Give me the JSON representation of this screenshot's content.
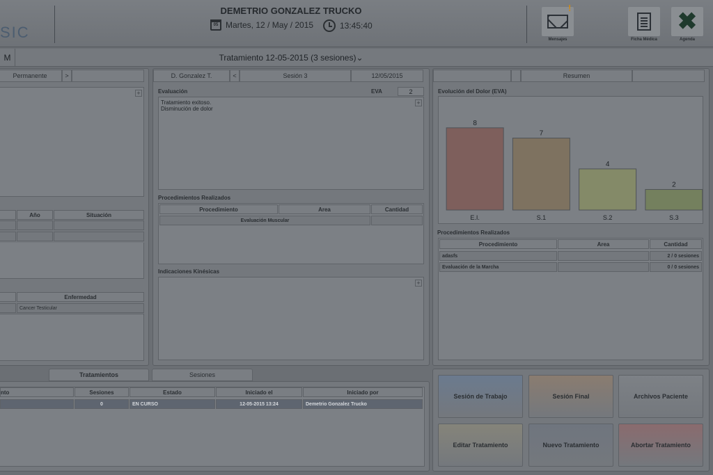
{
  "header": {
    "logo_text": "SIC",
    "patient_name": "DEMETRIO GONZALEZ TRUCKO",
    "date_text": "Martes, 12 / May / 2015",
    "calendar_day": "05",
    "time_text": "13:45:40",
    "alert_mark": "!",
    "tools": [
      {
        "label": "Mensajes",
        "icon": "mail-icon"
      },
      {
        "label": "Ficha Médica",
        "icon": "document-icon"
      },
      {
        "label": "Agenda",
        "icon": "close-icon"
      }
    ]
  },
  "treatment_bar": {
    "left_label": "M",
    "title": "Tratamiento 12-05-2015 (3 sesiones)",
    "dropdown_glyph": "⌄"
  },
  "left_panel": {
    "tab_label": "Permanente",
    "nav_glyph": ">",
    "history_headers": [
      "Año",
      "Situación"
    ],
    "disease_header": "Enfermedad",
    "disease_rows": [
      "Cancer Testicular"
    ],
    "plus": "+"
  },
  "session_panel": {
    "therapist": "D. Gonzalez T.",
    "prev_glyph": "<",
    "session_label": "Sesión 3",
    "session_date": "12/05/2015",
    "evaluation_title": "Evaluación",
    "eva_label": "EVA",
    "eva_value": "2",
    "evaluation_text": [
      "Tratamiento exitoso.",
      "Disminución de dolor"
    ],
    "procedures_title": "Procedimientos Realizados",
    "procedures_headers": [
      "Procedimiento",
      "Area",
      "Cantidad"
    ],
    "procedures_rows": [
      {
        "procedimiento": "Evaluación Muscular",
        "area": "",
        "cantidad": ""
      }
    ],
    "indications_title": "Indicaciones Kinésicas",
    "plus": "+"
  },
  "summary_panel": {
    "tab_label": "Resumen",
    "chart_title": "Evolución del Dolor (EVA)",
    "procedures_title": "Procedimientos Realizados",
    "procedures_headers": [
      "Procedimiento",
      "Area",
      "Cantidad"
    ],
    "procedures_rows": [
      {
        "procedimiento": "adasfs",
        "area": "",
        "cantidad": "2 / 0 sesiones"
      },
      {
        "procedimiento": "Evaluación de la Marcha",
        "area": "",
        "cantidad": "0 / 0 sesiones"
      }
    ]
  },
  "chart_data": {
    "type": "bar",
    "title": "Evolución del Dolor (EVA)",
    "categories": [
      "E.I.",
      "S.1",
      "S.2",
      "S.3"
    ],
    "values": [
      8,
      7,
      4,
      2
    ],
    "colors": [
      "#7e5f5c",
      "#7e7260",
      "#848a68",
      "#74805e"
    ],
    "ylim": [
      0,
      9
    ]
  },
  "lower": {
    "tabs": [
      "Tratamientos",
      "Sesiones"
    ],
    "headers": [
      "nto",
      "Sesiones",
      "Estado",
      "Iniciado el",
      "Iniciado por"
    ],
    "rows": [
      {
        "c0": "",
        "sesiones": "0",
        "estado": "EN CURSO",
        "iniciado_el": "12-05-2015 13:24",
        "iniciado_por": "Demetrio Gonzalez Trucko"
      }
    ]
  },
  "actions": [
    {
      "label": "Sesión de Trabajo",
      "color": "#6b7a8e"
    },
    {
      "label": "Sesión Final",
      "color": "#8a7c70"
    },
    {
      "label": "Archivos Paciente",
      "color": "#7d8186"
    },
    {
      "label": "Editar Tratamiento",
      "color": "#85847a"
    },
    {
      "label": "Nuevo Tratamiento",
      "color": "#6f757e"
    },
    {
      "label": "Abortar Tratamiento",
      "color": "#8a6b6e"
    }
  ]
}
